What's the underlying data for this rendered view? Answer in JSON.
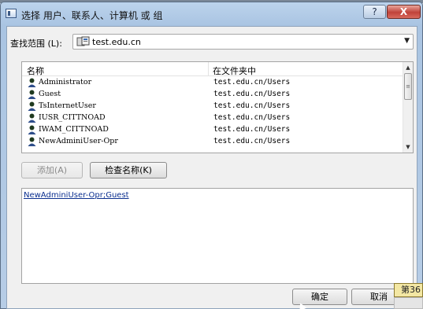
{
  "window": {
    "title": "选择 用户、联系人、计算机 或 组",
    "help_label": "?",
    "close_label": "X"
  },
  "scope": {
    "label": "查找范围 (L):",
    "value": "test.edu.cn"
  },
  "list": {
    "columns": [
      "名称",
      "在文件夹中"
    ],
    "rows": [
      {
        "name": "Administrator",
        "folder": "test.edu.cn/Users"
      },
      {
        "name": "Guest",
        "folder": "test.edu.cn/Users"
      },
      {
        "name": "TsInternetUser",
        "folder": "test.edu.cn/Users"
      },
      {
        "name": "IUSR_CITTNOAD",
        "folder": "test.edu.cn/Users"
      },
      {
        "name": "IWAM_CITTNOAD",
        "folder": "test.edu.cn/Users"
      },
      {
        "name": "NewAdminiUser-Opr",
        "folder": "test.edu.cn/Users"
      }
    ]
  },
  "buttons": {
    "add": "添加(A)",
    "check_names": "检查名称(K)",
    "ok": "确定",
    "cancel": "取消"
  },
  "selected": {
    "text": "NewAdminiUser-Opr;Guest"
  },
  "tooltip": {
    "text": "第36"
  }
}
